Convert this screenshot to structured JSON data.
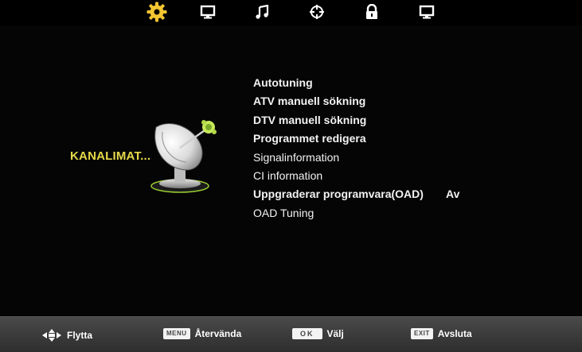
{
  "top_menu": {
    "active_color": "#f2c531",
    "icons": [
      "gear-icon",
      "monitor-icon",
      "music-note-icon",
      "crosshair-icon",
      "lock-icon",
      "tv-icon"
    ]
  },
  "category": {
    "label": "KANALIMAT...",
    "icon": "satellite-dish-icon",
    "color": "#e6d94a"
  },
  "menu": {
    "items": [
      {
        "label": "Autotuning"
      },
      {
        "label": "ATV manuell sökning"
      },
      {
        "label": "DTV manuell sökning"
      },
      {
        "label": "Programmet redigera"
      },
      {
        "label": "Signalinformation"
      },
      {
        "label": "CI information"
      },
      {
        "label": "Uppgraderar programvara(OAD)",
        "value": "Av"
      },
      {
        "label": "OAD Tuning"
      }
    ]
  },
  "footer": {
    "move": {
      "icon": "navigation-arrows-icon",
      "label": "Flytta"
    },
    "back": {
      "key": "MENU",
      "label": "Återvända"
    },
    "select": {
      "key": "OK",
      "label": "Välj"
    },
    "exit": {
      "key": "EXIT",
      "label": "Avsluta"
    }
  }
}
